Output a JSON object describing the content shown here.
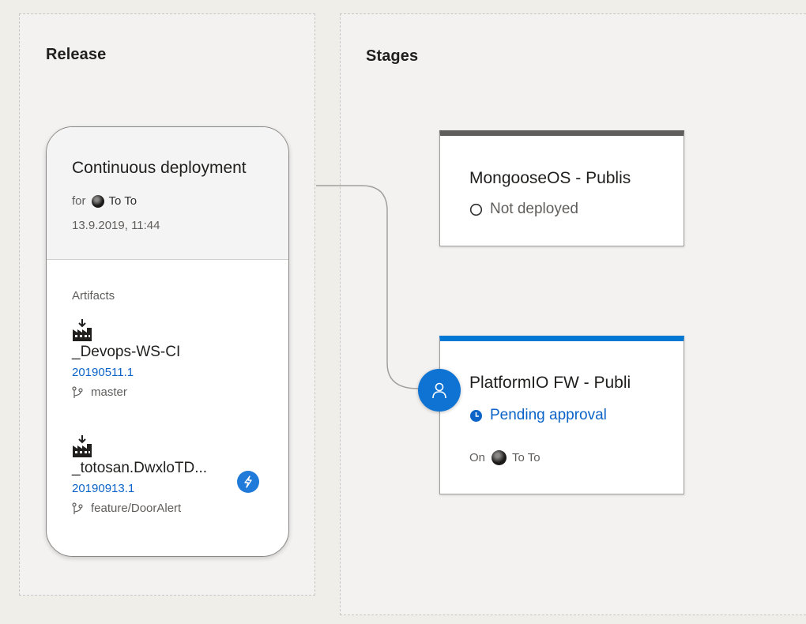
{
  "release": {
    "title": "Release",
    "trigger": {
      "title": "Continuous deployment",
      "for_label": "for",
      "requested_by": "To To",
      "date": "13.9.2019, 11:44"
    },
    "artifacts_label": "Artifacts",
    "artifacts": [
      {
        "name": "_Devops-WS-CI",
        "version": "20190511.1",
        "branch": "master",
        "icon": "build-artifact-icon"
      },
      {
        "name": "_totosan.DwxloTD...",
        "version": "20190913.1",
        "branch": "feature/DoorAlert",
        "icon": "build-artifact-icon",
        "badge_icon": "lightning-icon"
      }
    ]
  },
  "stages": {
    "title": "Stages",
    "items": [
      {
        "name": "MongooseOS - Publis",
        "status": "Not deployed",
        "status_icon": "circle-outline-icon",
        "accent": "#605e5c"
      },
      {
        "name": "PlatformIO FW - Publi",
        "status": "Pending approval",
        "status_icon": "clock-icon",
        "accent": "#0078d4",
        "on_label": "On",
        "on_user": "To To",
        "approver_icon": "person-icon"
      }
    ]
  },
  "colors": {
    "link_blue": "#0b63c7",
    "accent_blue": "#0078d4",
    "text_secondary": "#605e5c"
  }
}
